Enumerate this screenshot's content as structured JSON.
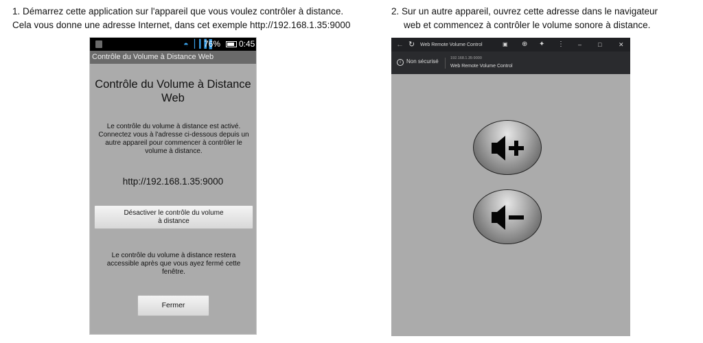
{
  "captions": {
    "step1_line1": "1. Démarrez cette application sur l'appareil que vous voulez contrôler à distance.",
    "step1_line2": "Cela vous donne une adresse Internet, dans cet exemple http://192.168.1.35:9000",
    "step2_line1": "2. Sur un autre appareil, ouvrez cette adresse dans le navigateur",
    "step2_line2": "web et commencez à contrôler le volume sonore à distance."
  },
  "phone": {
    "status": {
      "battery": "76%",
      "time": "0:45"
    },
    "app_title": "Contrôle du Volume à Distance Web",
    "heading": "Contrôle du Volume à Distance Web",
    "info": "Le contrôle du volume à distance est activé. Connectez vous à l'adresse ci-dessous depuis un autre appareil pour commencer à contrôler le volume à distance.",
    "url": "http://192.168.1.35:9000",
    "disable_button_line1": "Désactiver le contrôle du volume",
    "disable_button_line2": "à distance",
    "note": "Le contrôle du volume à distance restera accessible après que vous ayez fermé cette fenêtre.",
    "close_button": "Fermer"
  },
  "browser": {
    "tab_title": "Web Remote Volume Control",
    "not_secure": "Non sécurisé",
    "url": "192.168.1.35:9000",
    "page_title": "Web Remote Volume Control",
    "icons": [
      "back-icon",
      "refresh-icon",
      "translate-icon",
      "zoom-icon",
      "extensions-icon",
      "menu-icon",
      "minimize-icon",
      "maximize-icon",
      "close-icon",
      "info-icon",
      "volume-up-icon",
      "volume-down-icon"
    ]
  }
}
